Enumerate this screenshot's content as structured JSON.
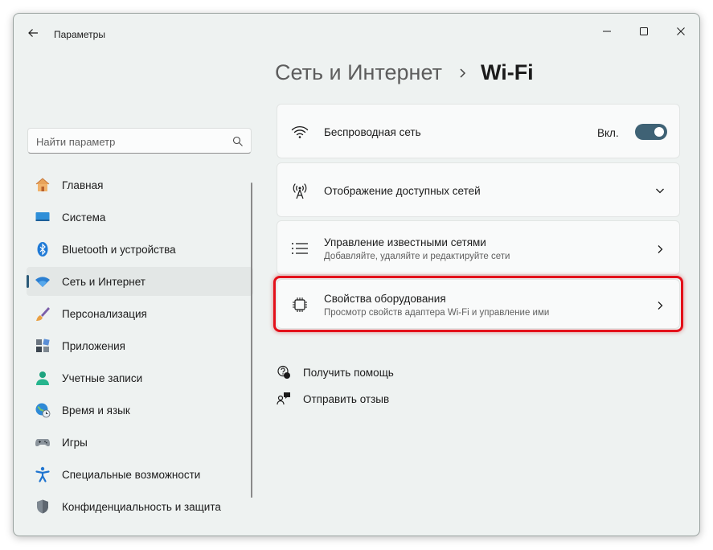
{
  "window": {
    "title": "Параметры"
  },
  "search": {
    "placeholder": "Найти параметр"
  },
  "sidebar": {
    "items": [
      {
        "label": "Главная",
        "icon": "home-icon"
      },
      {
        "label": "Система",
        "icon": "monitor-icon"
      },
      {
        "label": "Bluetooth и устройства",
        "icon": "bluetooth-icon"
      },
      {
        "label": "Сеть и Интернет",
        "icon": "wifi-icon",
        "selected": true
      },
      {
        "label": "Персонализация",
        "icon": "brush-icon"
      },
      {
        "label": "Приложения",
        "icon": "apps-icon"
      },
      {
        "label": "Учетные записи",
        "icon": "person-icon"
      },
      {
        "label": "Время и язык",
        "icon": "globe-clock-icon"
      },
      {
        "label": "Игры",
        "icon": "gamepad-icon"
      },
      {
        "label": "Специальные возможности",
        "icon": "accessibility-icon"
      },
      {
        "label": "Конфиденциальность и защита",
        "icon": "shield-icon"
      }
    ]
  },
  "breadcrumb": {
    "parent": "Сеть и Интернет",
    "current": "Wi-Fi"
  },
  "cards": {
    "wireless": {
      "title": "Беспроводная сеть",
      "toggle_label": "Вкл.",
      "toggle_on": true
    },
    "available": {
      "title": "Отображение доступных сетей"
    },
    "known": {
      "title": "Управление известными сетями",
      "subtitle": "Добавляйте, удаляйте и редактируйте сети"
    },
    "hardware": {
      "title": "Свойства оборудования",
      "subtitle": "Просмотр свойств адаптера Wi-Fi и управление ими"
    }
  },
  "links": {
    "help": "Получить помощь",
    "feedback": "Отправить отзыв"
  },
  "colors": {
    "accent": "#3f6275",
    "highlight": "#e3101a",
    "window_bg": "#eef2f1"
  }
}
